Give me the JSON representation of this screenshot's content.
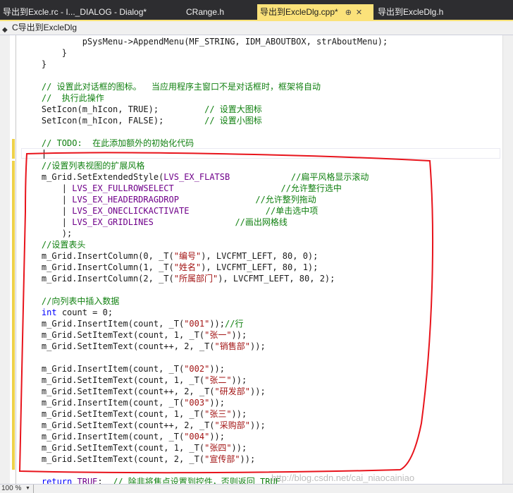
{
  "tabs": [
    {
      "label": "导出到Excle.rc - I..._DIALOG - Dialog*",
      "active": false
    },
    {
      "label": "CRange.h",
      "active": false
    },
    {
      "label": "导出到ExcleDlg.cpp*",
      "active": true
    },
    {
      "label": "导出到ExcleDlg.h",
      "active": false
    }
  ],
  "navbar": {
    "icon": "class-icon",
    "class_name": "C导出到ExcleDlg"
  },
  "code_lines": [
    [
      [
        "            pSysMenu->AppendMenu(MF_STRING, IDM_ABOUTBOX, strAboutMenu);",
        ""
      ]
    ],
    [
      [
        "        }",
        ""
      ]
    ],
    [
      [
        "    }",
        ""
      ]
    ],
    [
      [
        "",
        ""
      ]
    ],
    [
      [
        "    // 设置此对话框的图标。  当应用程序主窗口不是对话框时，框架将自动",
        "cm"
      ]
    ],
    [
      [
        "    //  执行此操作",
        "cm"
      ]
    ],
    [
      [
        "    SetIcon(m_hIcon, TRUE);         ",
        ""
      ],
      [
        "// 设置大图标",
        "cm"
      ]
    ],
    [
      [
        "    SetIcon(m_hIcon, FALSE);        ",
        ""
      ],
      [
        "// 设置小图标",
        "cm"
      ]
    ],
    [
      [
        "",
        ""
      ]
    ],
    [
      [
        "    // TODO:  在此添加额外的初始化代码",
        "cm"
      ]
    ],
    [
      [
        "",
        ""
      ]
    ],
    [
      [
        "    //设置列表视图的扩展风格",
        "cm"
      ]
    ],
    [
      [
        "    m_Grid.SetExtendedStyle(",
        ""
      ],
      [
        "LVS_EX_FLATSB",
        "mc"
      ],
      [
        "            ",
        ""
      ],
      [
        "//扁平风格显示滚动",
        "cm"
      ]
    ],
    [
      [
        "        | ",
        ""
      ],
      [
        "LVS_EX_FULLROWSELECT",
        "mc"
      ],
      [
        "                     ",
        ""
      ],
      [
        "//允许整行选中",
        "cm"
      ]
    ],
    [
      [
        "        | ",
        ""
      ],
      [
        "LVS_EX_HEADERDRAGDROP",
        "mc"
      ],
      [
        "               ",
        ""
      ],
      [
        "//允许整列拖动",
        "cm"
      ]
    ],
    [
      [
        "        | ",
        ""
      ],
      [
        "LVS_EX_ONECLICKACTIVATE",
        "mc"
      ],
      [
        "               ",
        ""
      ],
      [
        "//单击选中项",
        "cm"
      ]
    ],
    [
      [
        "        | ",
        ""
      ],
      [
        "LVS_EX_GRIDLINES",
        "mc"
      ],
      [
        "                ",
        ""
      ],
      [
        "//画出网格线",
        "cm"
      ]
    ],
    [
      [
        "        );",
        ""
      ]
    ],
    [
      [
        "    //设置表头",
        "cm"
      ]
    ],
    [
      [
        "    m_Grid.InsertColumn(0, _T(",
        ""
      ],
      [
        "\"编号\"",
        "st"
      ],
      [
        "), LVCFMT_LEFT, 80, 0);",
        ""
      ]
    ],
    [
      [
        "    m_Grid.InsertColumn(1, _T(",
        ""
      ],
      [
        "\"姓名\"",
        "st"
      ],
      [
        "), LVCFMT_LEFT, 80, 1);",
        ""
      ]
    ],
    [
      [
        "    m_Grid.InsertColumn(2, _T(",
        ""
      ],
      [
        "\"所属部门\"",
        "st"
      ],
      [
        "), LVCFMT_LEFT, 80, 2);",
        ""
      ]
    ],
    [
      [
        "",
        ""
      ]
    ],
    [
      [
        "    //向列表中插入数据",
        "cm"
      ]
    ],
    [
      [
        "    ",
        ""
      ],
      [
        "int",
        "kw"
      ],
      [
        " count = 0;",
        ""
      ]
    ],
    [
      [
        "    m_Grid.InsertItem(count, _T(",
        ""
      ],
      [
        "\"001\"",
        "st"
      ],
      [
        "));",
        ""
      ],
      [
        "//行",
        "cm"
      ]
    ],
    [
      [
        "    m_Grid.SetItemText(count, 1, _T(",
        ""
      ],
      [
        "\"张一\"",
        "st"
      ],
      [
        "));",
        ""
      ]
    ],
    [
      [
        "    m_Grid.SetItemText(count++, 2, _T(",
        ""
      ],
      [
        "\"销售部\"",
        "st"
      ],
      [
        "));",
        ""
      ]
    ],
    [
      [
        "",
        ""
      ]
    ],
    [
      [
        "    m_Grid.InsertItem(count, _T(",
        ""
      ],
      [
        "\"002\"",
        "st"
      ],
      [
        "));",
        ""
      ]
    ],
    [
      [
        "    m_Grid.SetItemText(count, 1, _T(",
        ""
      ],
      [
        "\"张二\"",
        "st"
      ],
      [
        "));",
        ""
      ]
    ],
    [
      [
        "    m_Grid.SetItemText(count++, 2, _T(",
        ""
      ],
      [
        "\"研发部\"",
        "st"
      ],
      [
        "));",
        ""
      ]
    ],
    [
      [
        "    m_Grid.InsertItem(count, _T(",
        ""
      ],
      [
        "\"003\"",
        "st"
      ],
      [
        "));",
        ""
      ]
    ],
    [
      [
        "    m_Grid.SetItemText(count, 1, _T(",
        ""
      ],
      [
        "\"张三\"",
        "st"
      ],
      [
        "));",
        ""
      ]
    ],
    [
      [
        "    m_Grid.SetItemText(count++, 2, _T(",
        ""
      ],
      [
        "\"采购部\"",
        "st"
      ],
      [
        "));",
        ""
      ]
    ],
    [
      [
        "    m_Grid.InsertItem(count, _T(",
        ""
      ],
      [
        "\"004\"",
        "st"
      ],
      [
        "));",
        ""
      ]
    ],
    [
      [
        "    m_Grid.SetItemText(count, 1, _T(",
        ""
      ],
      [
        "\"张四\"",
        "st"
      ],
      [
        "));",
        ""
      ]
    ],
    [
      [
        "    m_Grid.SetItemText(count, 2, _T(",
        ""
      ],
      [
        "\"宣传部\"",
        "st"
      ],
      [
        "));",
        ""
      ]
    ],
    [
      [
        "",
        ""
      ]
    ],
    [
      [
        "    ",
        ""
      ],
      [
        "return",
        "kw"
      ],
      [
        " ",
        ""
      ],
      [
        "TRUE",
        "mc"
      ],
      [
        ";  ",
        ""
      ],
      [
        "// 除非将焦点设置到控件，否则返回 TRUE",
        "cm"
      ]
    ]
  ],
  "statusbar": {
    "zoom": "100 %"
  },
  "watermark": "http://blog.csdn.net/cai_niaocainiao",
  "colors": {
    "active_tab": "#fbe27a",
    "tabbar_bg": "#2d2d30",
    "comment": "#108010",
    "string": "#a31515",
    "macro": "#6f008a",
    "keyword": "#0000ff",
    "change_marker": "#efd24a",
    "annotation": "#e8141c"
  }
}
